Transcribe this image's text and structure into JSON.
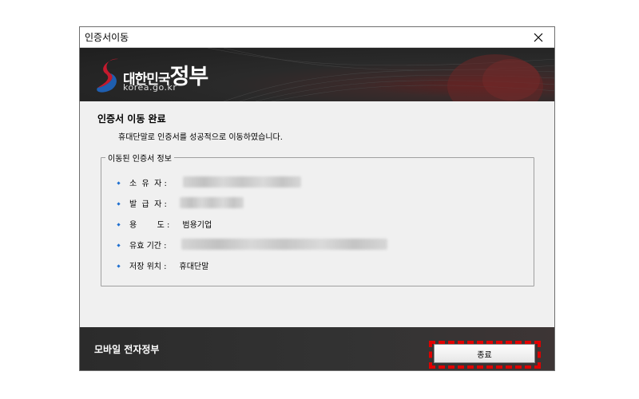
{
  "window": {
    "title": "인증서이동"
  },
  "banner": {
    "logo_text_small": "대한민국",
    "logo_text_big": "정부",
    "logo_url": "korea.go.kr"
  },
  "content": {
    "heading": "인증서 이동 완료",
    "message": "휴대단말로 인증서를 성공적으로 이동하였습니다.",
    "group_title": "이동된 인증서 정보",
    "fields": [
      {
        "label": "소  유  자 :",
        "value": ""
      },
      {
        "label": "발  급  자 :",
        "value": ""
      },
      {
        "label": "용        도 :",
        "value": "범용기업"
      },
      {
        "label": "유효 기간 :",
        "value": ""
      },
      {
        "label": "저장 위치 :",
        "value": "휴대단말"
      }
    ]
  },
  "footer": {
    "text": "모바일 전자정부",
    "close_label": "종료"
  },
  "colors": {
    "highlight": "#e00000",
    "bullet": "#1e6fd0",
    "footer_bg": "#2b2b2b",
    "window_bg": "#f0f0f0"
  }
}
